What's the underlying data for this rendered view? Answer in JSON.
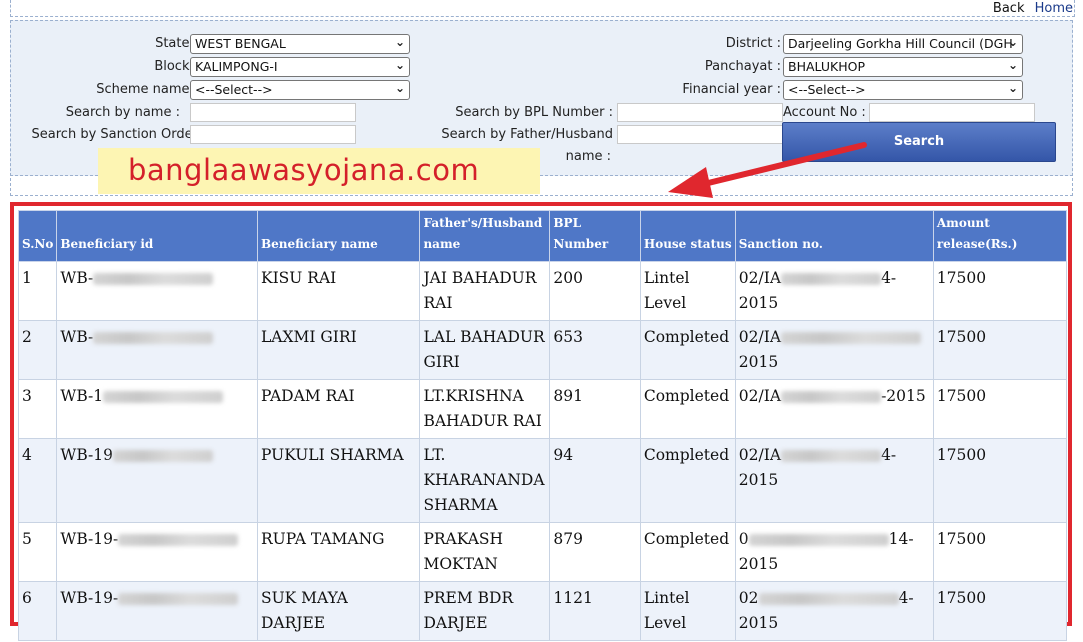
{
  "nav": {
    "back": "Back",
    "home": "Home"
  },
  "form": {
    "state_label": "State :",
    "state_value": "WEST BENGAL",
    "block_label": "Block :",
    "block_value": "KALIMPONG-I",
    "scheme_label": "Scheme name :",
    "scheme_value": "<--Select-->",
    "search_name_label": "Search by name :",
    "search_sanction_label": "Search by Sanction Order",
    "district_label": "District :",
    "district_value": "Darjeeling Gorkha Hill Council (DGH",
    "panchayat_label": "Panchayat :",
    "panchayat_value": "BHALUKHOP",
    "fy_label": "Financial year :",
    "fy_value": "<--Select-->",
    "bpl_label": "Search by BPL Number :",
    "father_label_1": "Search by Father/Husband",
    "father_label_2": "name :",
    "account_label": "Account No :",
    "search_button": "Search"
  },
  "watermark": "banglaawasyojana.com",
  "colors": {
    "header_bg": "#4f77c7",
    "highlight_border": "#e0272e",
    "button": "#3d5fb4",
    "watermark_text": "#d4202a",
    "watermark_bg": "#fdf5b3"
  },
  "table": {
    "headers": [
      "S.No",
      "Beneficiary id",
      "Beneficiary name",
      "Father's/Husband name",
      "BPL Number",
      "House status",
      "Sanction no.",
      "Amount release(Rs.)"
    ],
    "rows": [
      {
        "sno": "1",
        "id_prefix": "WB-",
        "name": "KISU RAI",
        "father": "JAI BAHADUR RAI",
        "bpl": "200",
        "status": "Lintel Level",
        "sanction_prefix": "02/IA",
        "sanction_suffix": "4-2015",
        "amount": "17500"
      },
      {
        "sno": "2",
        "id_prefix": "WB-",
        "name": "LAXMI GIRI",
        "father": "LAL BAHADUR GIRI",
        "bpl": "653",
        "status": "Completed",
        "sanction_prefix": "02/IA",
        "sanction_suffix": "2015",
        "amount": "17500"
      },
      {
        "sno": "3",
        "id_prefix": "WB-1",
        "name": "PADAM RAI",
        "father": "LT.KRISHNA BAHADUR RAI",
        "bpl": "891",
        "status": "Completed",
        "sanction_prefix": "02/IA",
        "sanction_suffix": "-2015",
        "amount": "17500"
      },
      {
        "sno": "4",
        "id_prefix": "WB-19",
        "name": "PUKULI SHARMA",
        "father": "LT. KHARANANDA SHARMA",
        "bpl": "94",
        "status": "Completed",
        "sanction_prefix": "02/IA",
        "sanction_suffix": "4-2015",
        "amount": "17500"
      },
      {
        "sno": "5",
        "id_prefix": "WB-19-",
        "name": "RUPA TAMANG",
        "father": "PRAKASH MOKTAN",
        "bpl": "879",
        "status": "Completed",
        "sanction_prefix": "0",
        "sanction_suffix": "14-2015",
        "amount": "17500"
      },
      {
        "sno": "6",
        "id_prefix": "WB-19-",
        "name": "SUK MAYA DARJEE",
        "father": "PREM BDR DARJEE",
        "bpl": "1121",
        "status": "Lintel Level",
        "sanction_prefix": "02",
        "sanction_suffix": "4-2015",
        "amount": "17500"
      }
    ]
  }
}
